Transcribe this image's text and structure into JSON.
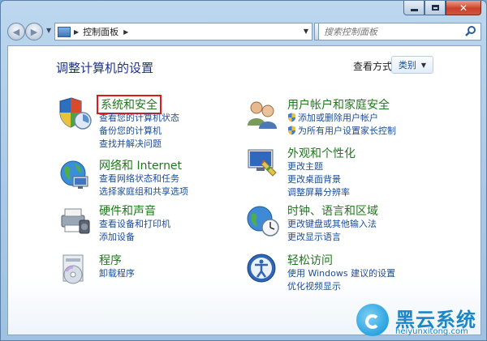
{
  "address": {
    "segment": "控制面板",
    "search_placeholder": "搜索控制面板"
  },
  "header": {
    "title": "调整计算机的设置",
    "view_by_label": "查看方式:",
    "view_by_value": "类别"
  },
  "categories": [
    {
      "title": "系统和安全",
      "icon": "system-security-icon",
      "links": [
        "查看您的计算机状态",
        "备份您的计算机",
        "查找并解决问题"
      ]
    },
    {
      "title": "网络和 Internet",
      "icon": "network-icon",
      "links": [
        "查看网络状态和任务",
        "选择家庭组和共享选项"
      ]
    },
    {
      "title": "硬件和声音",
      "icon": "hardware-sound-icon",
      "links": [
        "查看设备和打印机",
        "添加设备"
      ]
    },
    {
      "title": "程序",
      "icon": "programs-icon",
      "links": [
        "卸载程序"
      ]
    },
    {
      "title": "用户帐户和家庭安全",
      "icon": "user-accounts-icon",
      "links": [
        "添加或删除用户帐户",
        "为所有用户设置家长控制"
      ]
    },
    {
      "title": "外观和个性化",
      "icon": "appearance-icon",
      "links": [
        "更改主题",
        "更改桌面背景",
        "调整屏幕分辨率"
      ]
    },
    {
      "title": "时钟、语言和区域",
      "icon": "clock-language-region-icon",
      "links": [
        "更改键盘或其他输入法",
        "更改显示语言"
      ]
    },
    {
      "title": "轻松访问",
      "icon": "ease-of-access-icon",
      "links": [
        "使用 Windows 建议的设置",
        "优化视频显示"
      ]
    }
  ],
  "watermark": {
    "title": "黑云系统",
    "url": "heiyunxitong.com"
  },
  "colors": {
    "link": "#1a4d99",
    "category_title": "#21771e",
    "title": "#1e3287",
    "highlight_box": "#e11919"
  }
}
